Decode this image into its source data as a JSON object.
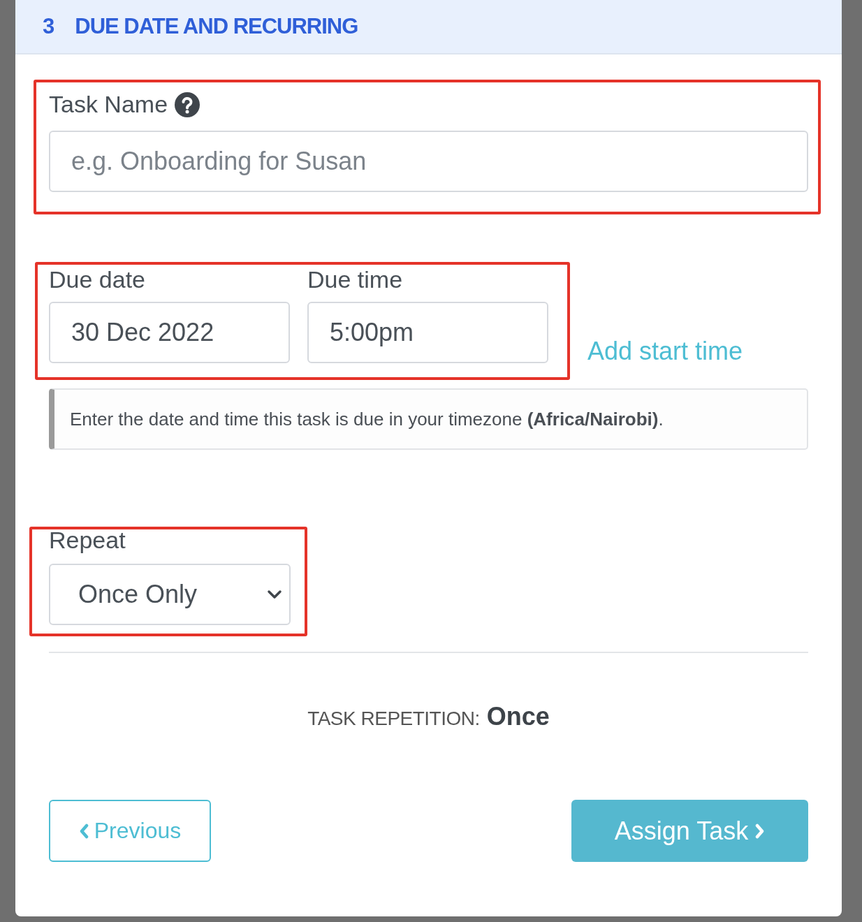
{
  "step": {
    "number": "3",
    "title": "DUE DATE AND RECURRING"
  },
  "task_name": {
    "label": "Task Name",
    "placeholder": "e.g. Onboarding for Susan"
  },
  "due_date": {
    "label": "Due date",
    "value": "30 Dec 2022"
  },
  "due_time": {
    "label": "Due time",
    "value": "5:00pm"
  },
  "add_start_time": "Add start time",
  "timezone_note": "Enter the date and time this task is due in your timezone **(Africa/Nairobi)**.",
  "repeat": {
    "label": "Repeat",
    "value": "Once Only"
  },
  "summary": {
    "label": "TASK REPETITION:",
    "value": "Once"
  },
  "buttons": {
    "previous": "Previous",
    "assign": "Assign Task"
  }
}
